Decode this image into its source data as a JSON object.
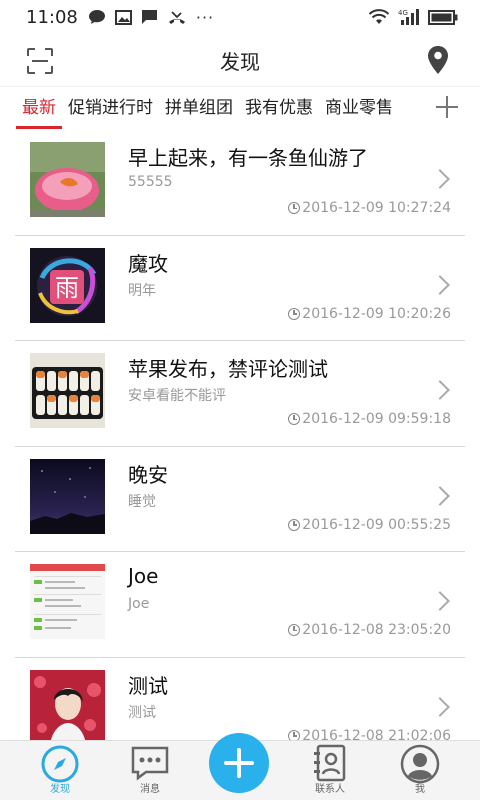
{
  "status_bar": {
    "time": "11:08",
    "more": "···",
    "icons_left": [
      "chat-bubble-icon",
      "image-icon",
      "message-icon",
      "missed-call-icon"
    ],
    "icons_right": [
      "wifi-icon",
      "signal-4g-icon",
      "battery-icon"
    ],
    "network": "4G"
  },
  "header": {
    "title": "发现",
    "left_icon": "scan-icon",
    "right_icon": "location-pin-icon"
  },
  "tabs": [
    "最新",
    "促销进行时",
    "拼单组团",
    "我有优惠",
    "商业零售"
  ],
  "feed": [
    {
      "title": "早上起来，有一条鱼仙游了",
      "subtitle": "55555",
      "time": "2016-12-09 10:27:24",
      "thumb": "goldfish-bowl-photo"
    },
    {
      "title": "魔攻",
      "subtitle": "明年",
      "time": "2016-12-09 10:20:26",
      "thumb": "logo-yu-photo"
    },
    {
      "title": "苹果发布，禁评论测试",
      "subtitle": "安卓看能不能评",
      "time": "2016-12-09 09:59:18",
      "thumb": "sushi-photo"
    },
    {
      "title": "晚安",
      "subtitle": "睡觉",
      "time": "2016-12-09 00:55:25",
      "thumb": "night-sky-photo"
    },
    {
      "title": "Joe",
      "subtitle": "Joe",
      "time": "2016-12-08 23:05:20",
      "thumb": "app-screenshot-photo"
    },
    {
      "title": "测试",
      "subtitle": "测试",
      "time": "2016-12-08 21:02:06",
      "thumb": "portrait-photo"
    }
  ],
  "bottom_nav": {
    "items": [
      {
        "label": "发现",
        "icon": "compass-icon"
      },
      {
        "label": "消息",
        "icon": "chat-icon"
      },
      {
        "label": "",
        "icon": "plus-icon"
      },
      {
        "label": "联系人",
        "icon": "contacts-book-icon"
      },
      {
        "label": "我",
        "icon": "avatar-icon"
      }
    ]
  },
  "colors": {
    "accent_red": "#d9262c",
    "accent_blue": "#2ab0ea"
  }
}
